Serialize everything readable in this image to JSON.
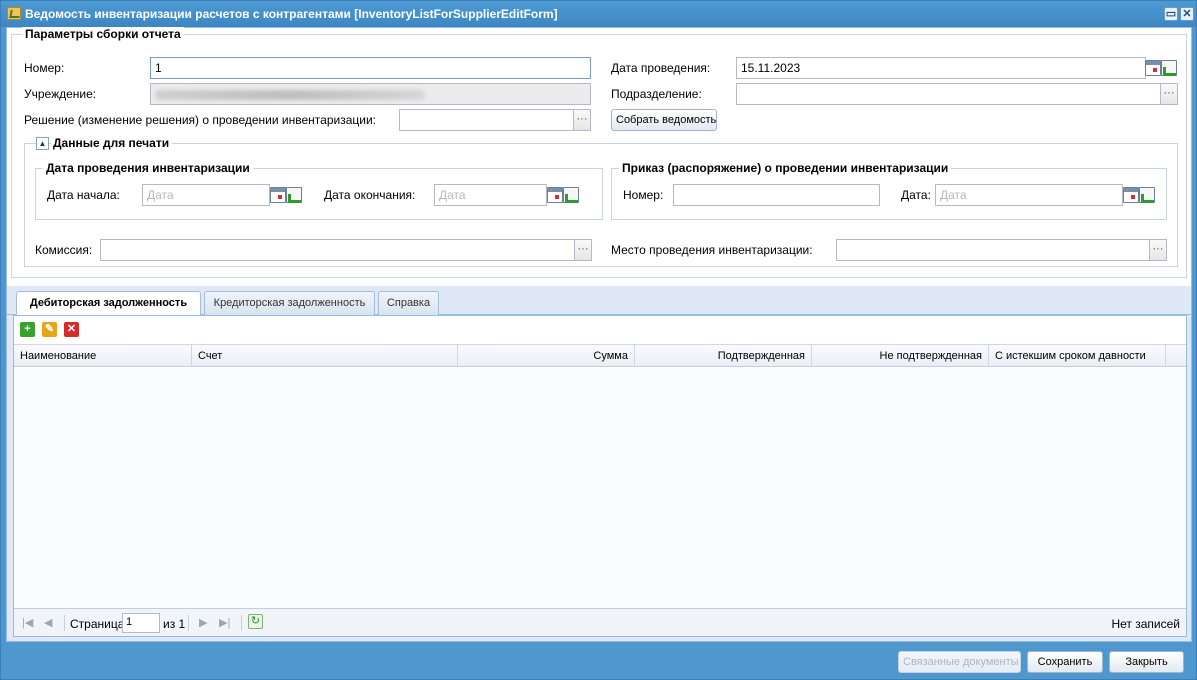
{
  "window": {
    "title": "Ведомость инвентаризации расчетов с контрагентами [InventoryListForSupplierEditForm]",
    "buttons": [
      "restore",
      "close"
    ]
  },
  "params": {
    "legend": "Параметры сборки отчета",
    "number_label": "Номер:",
    "number_value": "1",
    "institution_label": "Учреждение:",
    "decision_label": "Решение (изменение решения) о проведении инвентаризации:",
    "date_label": "Дата проведения:",
    "date_value": "15.11.2023",
    "subdivision_label": "Подразделение:",
    "collect_button": "Собрать ведомость"
  },
  "print_data": {
    "legend": "Данные для печати",
    "inventory_dates": {
      "legend": "Дата проведения инвентаризации",
      "start_label": "Дата начала:",
      "start_placeholder": "Дата",
      "end_label": "Дата окончания:",
      "end_placeholder": "Дата"
    },
    "order": {
      "legend": "Приказ (распоряжение) о проведении инвентаризации",
      "number_label": "Номер:",
      "date_label": "Дата:",
      "date_placeholder": "Дата"
    },
    "commission_label": "Комиссия:",
    "place_label": "Место проведения инвентаризации:"
  },
  "tabs": [
    {
      "label": "Дебиторская задолженность",
      "active": true
    },
    {
      "label": "Кредиторская задолженность",
      "active": false
    },
    {
      "label": "Справка",
      "active": false
    }
  ],
  "grid": {
    "columns": [
      "Наименование",
      "Счет",
      "Сумма",
      "Подтвержденная",
      "Не подтвержденная",
      "С истекшим сроком давности"
    ],
    "rows": []
  },
  "pager": {
    "page_label": "Страница",
    "page_value": "1",
    "of_label": "из 1",
    "status": "Нет записей"
  },
  "footer": {
    "linked_docs": "Связанные документы",
    "save": "Сохранить",
    "close": "Закрыть"
  },
  "colors": {
    "window_frame": "#4f97cf",
    "panel_bg": "#dfe8f6",
    "add_icon": "#3aa12f",
    "edit_icon": "#e6a417",
    "delete_icon": "#d42b2b"
  }
}
